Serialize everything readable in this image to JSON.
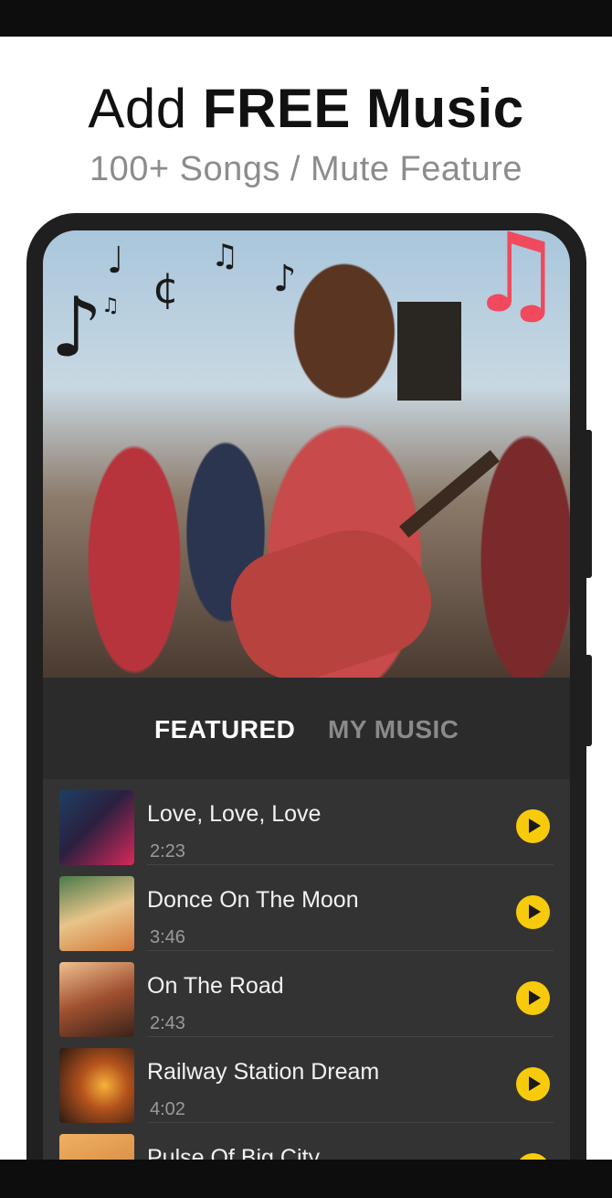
{
  "header": {
    "title_prefix": "Add ",
    "title_bold": "FREE Music",
    "subtitle": "100+ Songs / Mute Feature"
  },
  "decor": {
    "note_icon": "music-note",
    "accent_color": "#f04a5c"
  },
  "tabs": [
    {
      "label": "FEATURED",
      "active": true
    },
    {
      "label": "MY MUSIC",
      "active": false
    }
  ],
  "tracks": [
    {
      "title": "Love, Love, Love",
      "duration": "2:23"
    },
    {
      "title": "Donce On The Moon",
      "duration": "3:46"
    },
    {
      "title": "On The Road",
      "duration": "2:43"
    },
    {
      "title": "Railway Station Dream",
      "duration": "4:02"
    },
    {
      "title": "Pulse Of Big City",
      "duration": ""
    }
  ],
  "colors": {
    "play_button": "#f7cb0b",
    "list_background": "#333333",
    "phone_frame": "#1f1f1f"
  }
}
